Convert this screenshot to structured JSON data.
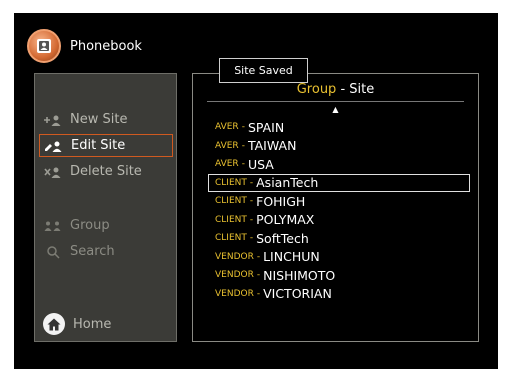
{
  "app": {
    "title": "Phonebook",
    "icon": "contact-card-icon"
  },
  "sidebar": {
    "items": [
      {
        "label": "New Site",
        "icon": "add-contact-icon",
        "active": false
      },
      {
        "label": "Edit Site",
        "icon": "edit-contact-icon",
        "active": true
      },
      {
        "label": "Delete Site",
        "icon": "delete-contact-icon",
        "active": false
      },
      {
        "label": "Group",
        "icon": "group-icon",
        "active": false
      },
      {
        "label": "Search",
        "icon": "search-icon",
        "active": false
      }
    ],
    "home_label": "Home"
  },
  "list": {
    "header_group": "Group",
    "header_sep": " - ",
    "header_site": "Site",
    "rows": [
      {
        "group": "AVER",
        "name": "SPAIN"
      },
      {
        "group": "AVER",
        "name": "TAIWAN"
      },
      {
        "group": "AVER",
        "name": "USA"
      },
      {
        "group": "CLIENT",
        "name": "AsianTech",
        "selected": true
      },
      {
        "group": "CLIENT",
        "name": "FOHIGH"
      },
      {
        "group": "CLIENT",
        "name": "POLYMAX"
      },
      {
        "group": "CLIENT",
        "name": "SoftTech"
      },
      {
        "group": "VENDOR",
        "name": "LINCHUN"
      },
      {
        "group": "VENDOR",
        "name": "NISHIMOTO"
      },
      {
        "group": "VENDOR",
        "name": "VICTORIAN"
      }
    ],
    "row_sep": "-"
  },
  "toast": {
    "message": "Site Saved"
  },
  "colors": {
    "accent": "#e8c030",
    "active_border": "#d05a20",
    "panel": "#3b3b37"
  }
}
